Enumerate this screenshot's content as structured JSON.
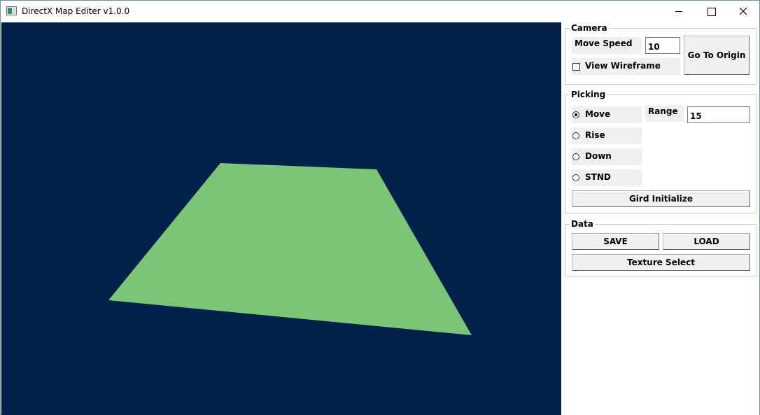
{
  "window": {
    "title": "DirectX Map Editer v1.0.0"
  },
  "viewport": {
    "background_color": "#01214a",
    "plane_color": "#7bc576"
  },
  "camera": {
    "group_title": "Camera",
    "move_speed_label": "Move Speed",
    "move_speed_value": "10",
    "view_wireframe_label": "View Wireframe",
    "view_wireframe_checked": false,
    "go_to_origin_label": "Go To Origin"
  },
  "picking": {
    "group_title": "Picking",
    "modes": [
      {
        "label": "Move",
        "selected": true
      },
      {
        "label": "Rise",
        "selected": false
      },
      {
        "label": "Down",
        "selected": false
      },
      {
        "label": "STND",
        "selected": false
      }
    ],
    "range_label": "Range",
    "range_value": "15",
    "grid_initialize_label": "Gird Initialize"
  },
  "data": {
    "group_title": "Data",
    "save_label": "SAVE",
    "load_label": "LOAD",
    "texture_select_label": "Texture Select"
  }
}
